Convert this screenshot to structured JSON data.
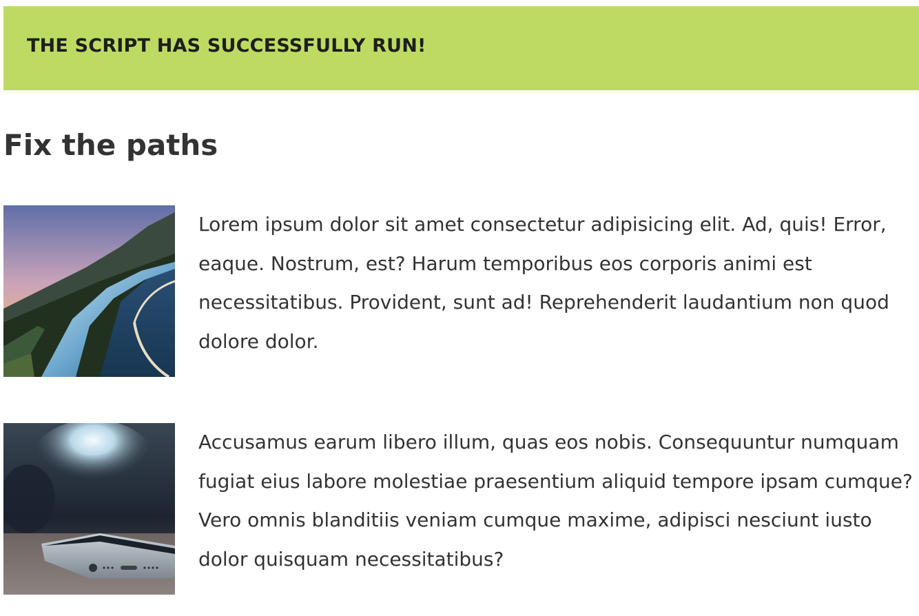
{
  "banner": {
    "message": "THE SCRIPT HAS SUCCESSFULLY RUN!",
    "background_color": "#bddb62"
  },
  "page": {
    "title": "Fix the paths"
  },
  "articles": [
    {
      "image_icon": "road-guardrail-photo",
      "text": "Lorem ipsum dolor sit amet consectetur adipisicing elit. Ad, quis! Error, eaque. Nostrum, est? Harum temporibus eos corporis animi est necessitatibus. Provident, sunt ad! Reprehenderit laudantium non quod dolore dolor."
    },
    {
      "image_icon": "smartphone-photo",
      "text": "Accusamus earum libero illum, quas eos nobis. Consequuntur numquam fugiat eius labore molestiae praesentium aliquid tempore ipsam cumque? Vero omnis blanditiis veniam cumque maxime, adipisci nesciunt iusto dolor quisquam necessitatibus?"
    }
  ]
}
